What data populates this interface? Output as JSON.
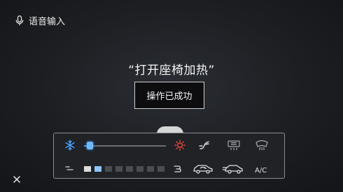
{
  "voice": {
    "icon": "microphone-icon",
    "label": "语音输入"
  },
  "command_text": "“打开座椅加热”",
  "status_text": "操作已成功",
  "climate": {
    "temperature_level": 0.06,
    "fan_speed_level": 2,
    "fan_speed_max": 8,
    "ac_label": "A/C",
    "accent_cold": "#4aa3ff",
    "accent_hot": "#ff4a3a",
    "icons": [
      "snowflake-icon",
      "sun-heat-icon",
      "seat-airflow-icon",
      "rear-defrost-icon",
      "front-defrost-icon",
      "fan-icon",
      "airflow-wave-icon",
      "recirculation-car-icon",
      "fresh-air-car-icon"
    ]
  },
  "close_icon": "close-icon"
}
